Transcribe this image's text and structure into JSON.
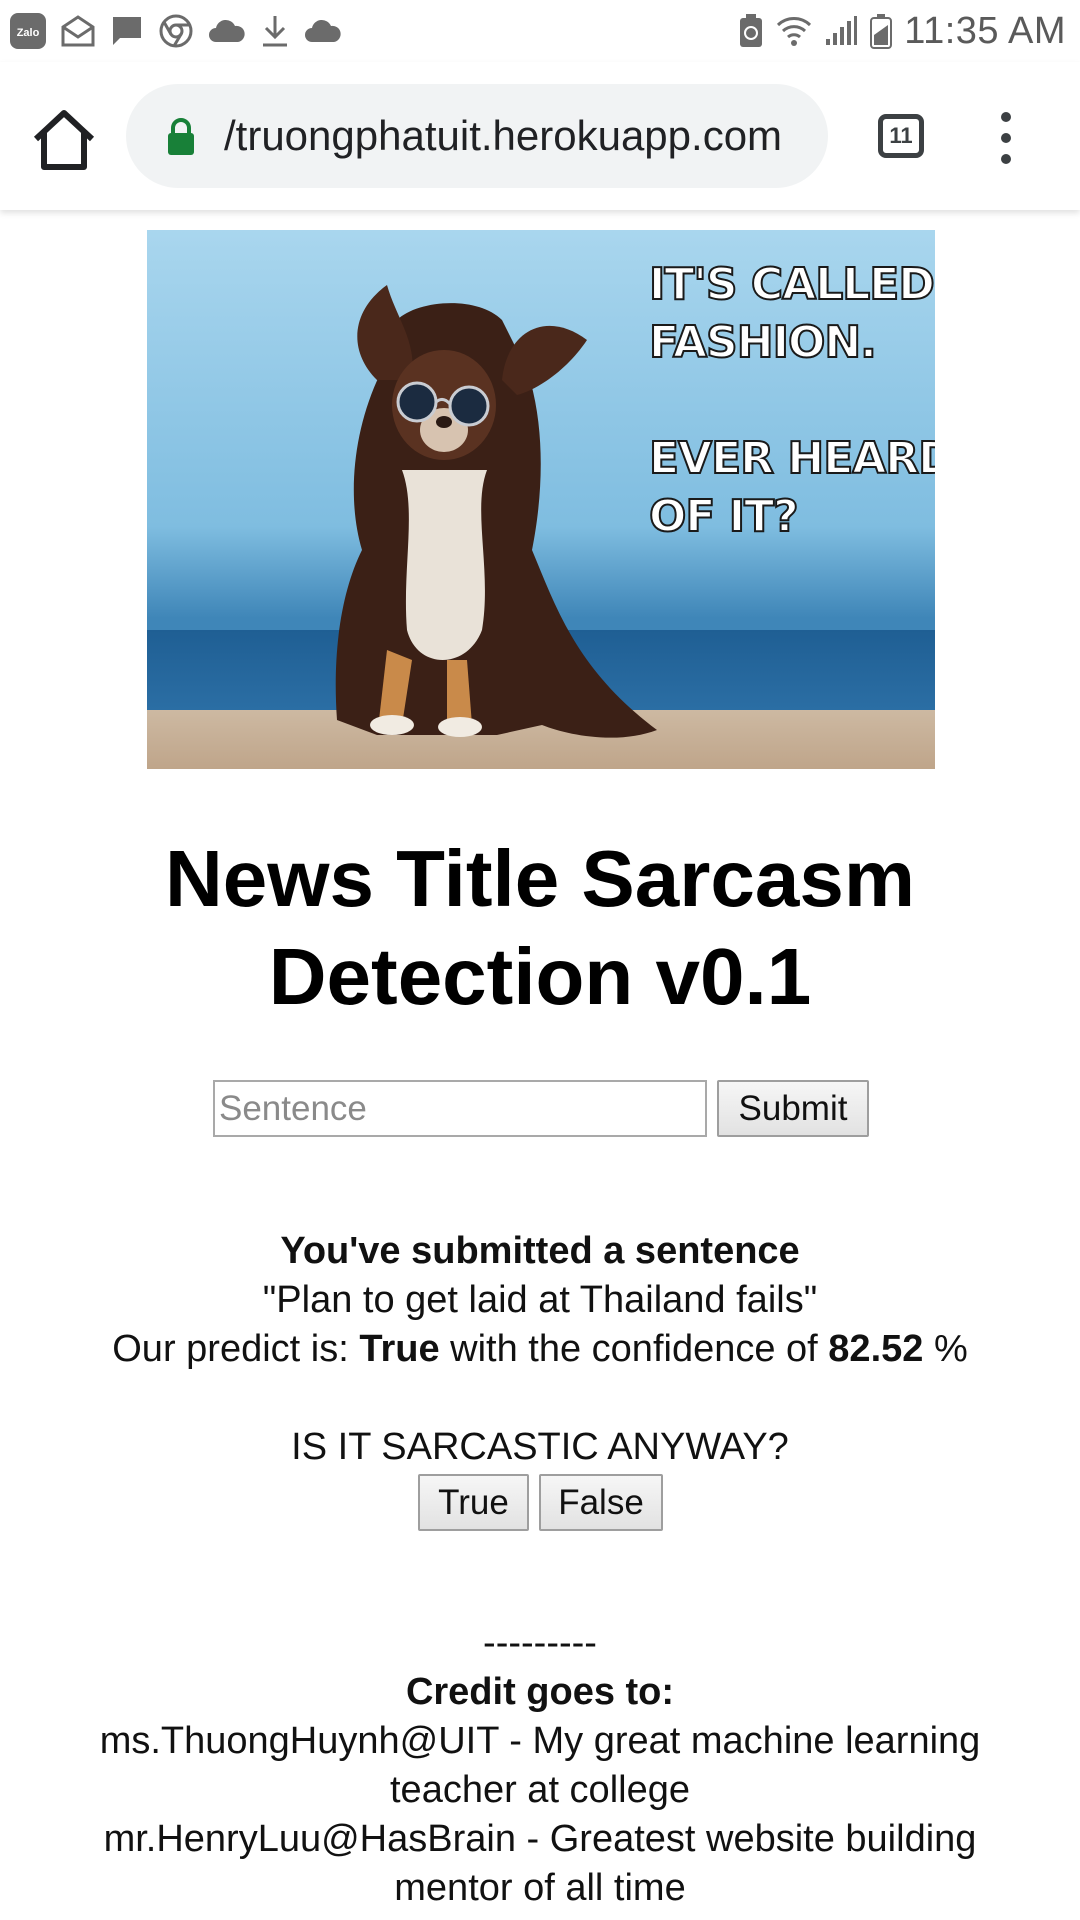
{
  "status_bar": {
    "time": "11:35 AM",
    "left_icons": [
      "zalo-icon",
      "email-icon",
      "message-icon",
      "chrome-icon",
      "cloud-icon",
      "download-icon",
      "cloud-icon"
    ],
    "right_icons": [
      "recycle-battery-icon",
      "wifi-icon",
      "signal-icon",
      "battery-icon"
    ],
    "zalo_label": "Zalo"
  },
  "browser": {
    "url_prefix": "/",
    "url": "/truongphatuit.herokuapp.com",
    "tab_count": "11"
  },
  "hero": {
    "caption_line1": "IT'S CALLED",
    "caption_line2": "FASHION.",
    "caption_line3": "EVER HEARD",
    "caption_line4": "OF IT?"
  },
  "page": {
    "title": "News Title Sarcasm Detection v0.1",
    "input_placeholder": "Sentence",
    "input_value": "",
    "submit_label": "Submit"
  },
  "result": {
    "heading": "You've submitted a sentence",
    "sentence": "\"Plan to get laid at Thailand fails\"",
    "predict_prefix": "Our predict is:",
    "predict_value": "True",
    "confidence_prefix": "with the confidence of",
    "confidence_value": "82.52",
    "confidence_unit": "%"
  },
  "feedback": {
    "question": "IS IT SARCASTIC ANYWAY?",
    "true_label": "True",
    "false_label": "False"
  },
  "credits": {
    "divider": "---------",
    "heading": "Credit goes to:",
    "entries": [
      "ms.ThuongHuynh@UIT - My great machine learning teacher at college",
      "mr.HenryLuu@HasBrain - Greatest website building mentor of all time"
    ]
  },
  "colors": {
    "lock_green": "#188038",
    "toolbar_gray": "#f1f3f4",
    "status_gray": "#5a5a5a"
  }
}
